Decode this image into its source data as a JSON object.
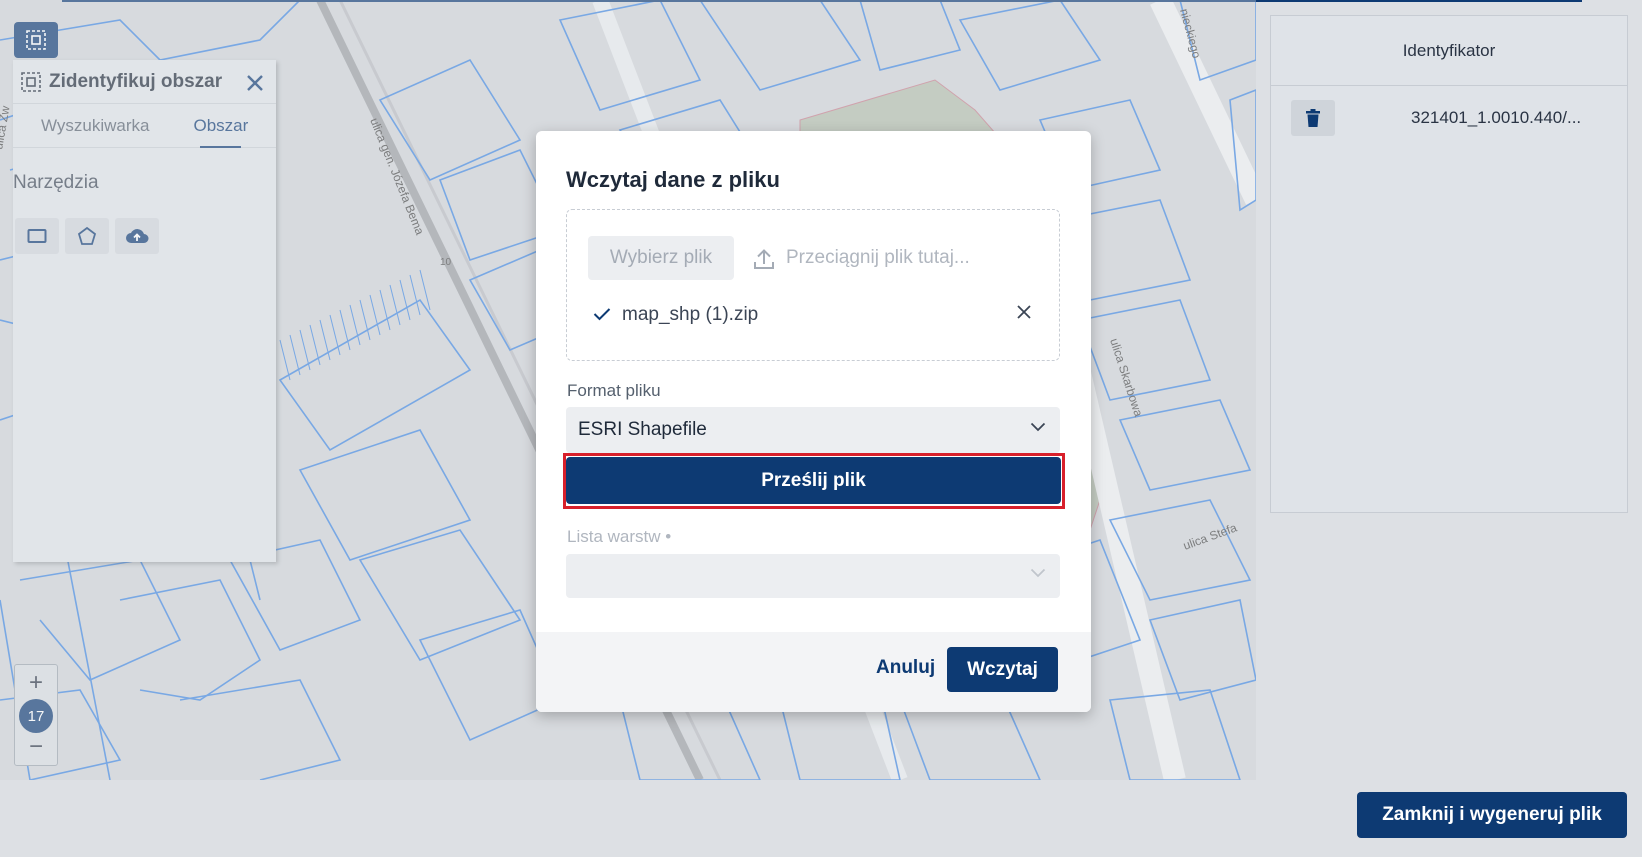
{
  "map": {
    "zoom_level": "17",
    "street_labels": [
      "ulica gen. Józefa Bema",
      "ulica Skarbowa",
      "ulica Stefa",
      "nieckiego",
      "ulica Zw",
      "10"
    ]
  },
  "left_panel": {
    "title": "Zidentyfikuj obszar",
    "tabs": [
      {
        "label": "Wyszukiwarka"
      },
      {
        "label": "Obszar"
      }
    ],
    "tools_label": "Narzędzia",
    "tools": [
      "rectangle-icon",
      "pentagon-icon",
      "cloud-upload-icon"
    ]
  },
  "right_panel": {
    "column_header": "Identyfikator",
    "rows": [
      {
        "identifier": "321401_1.0010.440/..."
      }
    ]
  },
  "bottom_button": "Zamknij i wygeneruj plik",
  "modal": {
    "title": "Wczytaj dane z pliku",
    "choose_file": "Wybierz plik",
    "drop_hint": "Przeciągnij plik tutaj...",
    "file_name": "map_shp (1).zip",
    "format_label": "Format pliku",
    "format_value": "ESRI Shapefile",
    "upload_button": "Prześlij plik",
    "layers_label": "Lista warstw •",
    "layers_value": "",
    "cancel": "Anuluj",
    "load": "Wczytaj"
  },
  "colors": {
    "primary": "#0d3a73",
    "highlight": "#d8202b",
    "map_lines": "#3f86e0"
  }
}
